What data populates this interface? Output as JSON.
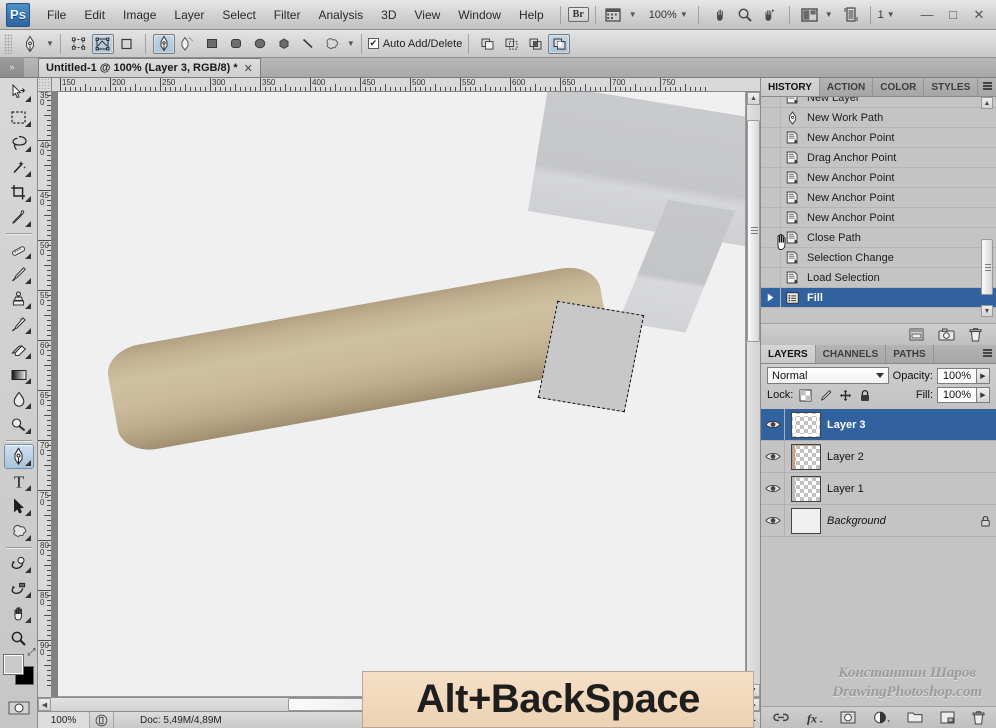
{
  "app": {
    "logo_text": "Ps",
    "window_controls": {
      "minimize": "—",
      "maximize": "□",
      "close": "✕"
    }
  },
  "menubar": {
    "items": [
      "File",
      "Edit",
      "Image",
      "Layer",
      "Select",
      "Filter",
      "Analysis",
      "3D",
      "View",
      "Window",
      "Help"
    ],
    "bridge_label": "Br",
    "zoom_level": "100%",
    "screen_mode_count": "1",
    "icons": [
      "bridge-icon",
      "view-extras-icon",
      "hand-icon",
      "zoom-icon",
      "rotate-view-icon",
      "workspace-icon",
      "screen-mode-icon"
    ]
  },
  "optionsbar": {
    "tool_icon": "pen-tool-icon",
    "mode_buttons": [
      "shape-layers-icon",
      "paths-icon",
      "fill-pixels-icon"
    ],
    "shape_buttons": [
      "pen-icon",
      "freeform-pen-icon",
      "rectangle-icon",
      "rounded-rectangle-icon",
      "ellipse-icon",
      "polygon-icon",
      "line-icon",
      "custom-shape-icon"
    ],
    "auto_add_delete": {
      "label": "Auto Add/Delete",
      "checked": true
    },
    "path_ops": [
      "add-to-path-icon",
      "subtract-from-path-icon",
      "intersect-path-icon",
      "exclude-path-icon"
    ]
  },
  "tabbar": {
    "document_title": "Untitled-1 @ 100% (Layer 3, RGB/8) *",
    "close_label": "✕"
  },
  "toolbox": {
    "tools": [
      {
        "name": "move-tool",
        "active": false
      },
      {
        "name": "rectangular-marquee-tool",
        "active": false
      },
      {
        "name": "lasso-tool",
        "active": false
      },
      {
        "name": "magic-wand-tool",
        "active": false
      },
      {
        "name": "crop-tool",
        "active": false
      },
      {
        "name": "eyedropper-tool",
        "active": false
      },
      {
        "name": "healing-brush-tool",
        "active": false
      },
      {
        "name": "brush-tool",
        "active": false
      },
      {
        "name": "clone-stamp-tool",
        "active": false
      },
      {
        "name": "history-brush-tool",
        "active": false
      },
      {
        "name": "eraser-tool",
        "active": false
      },
      {
        "name": "gradient-tool",
        "active": false
      },
      {
        "name": "blur-tool",
        "active": false
      },
      {
        "name": "dodge-tool",
        "active": false
      },
      {
        "name": "pen-tool",
        "active": true
      },
      {
        "name": "type-tool",
        "active": false
      },
      {
        "name": "path-selection-tool",
        "active": false
      },
      {
        "name": "custom-shape-tool",
        "active": false
      },
      {
        "name": "3d-rotate-tool",
        "active": false
      },
      {
        "name": "3d-orbit-tool",
        "active": false
      },
      {
        "name": "hand-tool",
        "active": false
      },
      {
        "name": "zoom-tool",
        "active": false
      }
    ],
    "foreground_color": "#c9c9c9",
    "background_color": "#000000"
  },
  "rulers": {
    "horizontal_labels": [
      "150",
      "200",
      "250",
      "300",
      "350",
      "400",
      "450",
      "500",
      "550",
      "600",
      "650",
      "700",
      "750"
    ],
    "vertical_labels": [
      "350",
      "400",
      "450",
      "500",
      "550",
      "600",
      "650",
      "700",
      "750",
      "800",
      "850",
      "900"
    ],
    "unit_spacing_px": 50
  },
  "canvas": {
    "artwork_description": "hammer-illustration",
    "handle_color": "#c6b697",
    "head_color": "#c8c9cc",
    "selection_fill": "#c8c8c8",
    "background_color": "#f0f0f0"
  },
  "keyboard_overlay": {
    "text": "Alt+BackSpace",
    "background": "#f2d9bd"
  },
  "history_panel": {
    "tabs": [
      {
        "label": "HISTORY",
        "active": true
      },
      {
        "label": "ACTION",
        "active": false
      },
      {
        "label": "COLOR",
        "active": false
      },
      {
        "label": "STYLES",
        "active": false
      }
    ],
    "items": [
      {
        "label": "New Layer",
        "icon": "history-state-icon",
        "selected": false,
        "partial": true
      },
      {
        "label": "New Work Path",
        "icon": "pen-tool-icon",
        "selected": false
      },
      {
        "label": "New Anchor Point",
        "icon": "history-state-icon",
        "selected": false
      },
      {
        "label": "Drag Anchor Point",
        "icon": "history-state-icon",
        "selected": false
      },
      {
        "label": "New Anchor Point",
        "icon": "history-state-icon",
        "selected": false
      },
      {
        "label": "New Anchor Point",
        "icon": "history-state-icon",
        "selected": false
      },
      {
        "label": "New Anchor Point",
        "icon": "history-state-icon",
        "selected": false
      },
      {
        "label": "Close Path",
        "icon": "history-state-icon",
        "selected": false
      },
      {
        "label": "Selection Change",
        "icon": "history-state-icon",
        "selected": false
      },
      {
        "label": "Load Selection",
        "icon": "history-state-icon",
        "selected": false
      },
      {
        "label": "Fill",
        "icon": "fill-state-icon",
        "selected": true
      }
    ],
    "footer_buttons": [
      "new-document-from-state-icon",
      "new-snapshot-icon",
      "delete-state-icon"
    ]
  },
  "layers_panel": {
    "tabs": [
      {
        "label": "LAYERS",
        "active": true
      },
      {
        "label": "CHANNELS",
        "active": false
      },
      {
        "label": "PATHS",
        "active": false
      }
    ],
    "blend_mode": "Normal",
    "opacity_label": "Opacity:",
    "opacity_value": "100%",
    "fill_label": "Fill:",
    "fill_value": "100%",
    "lock_label": "Lock:",
    "lock_icons": [
      "lock-transparent-pixels-icon",
      "lock-image-pixels-icon",
      "lock-position-icon",
      "lock-all-icon"
    ],
    "layers": [
      {
        "name": "Layer 3",
        "visible": true,
        "selected": true,
        "locked": false,
        "thumb": "transparent"
      },
      {
        "name": "Layer 2",
        "visible": true,
        "selected": false,
        "locked": false,
        "thumb": "transparent"
      },
      {
        "name": "Layer 1",
        "visible": true,
        "selected": false,
        "locked": false,
        "thumb": "transparent"
      },
      {
        "name": "Background",
        "visible": true,
        "selected": false,
        "locked": true,
        "thumb": "solid"
      }
    ],
    "footer_buttons": [
      "link-layers-icon",
      "layer-style-fx-icon",
      "add-layer-mask-icon",
      "new-adjustment-layer-icon",
      "new-group-icon",
      "new-layer-icon",
      "delete-layer-icon"
    ]
  },
  "statusbar": {
    "zoom": "100%",
    "doc_info": "Doc: 5,49M/4,89M"
  },
  "watermark": {
    "line1": "Константин Шаров",
    "line2": "DrawingPhotoshop.com"
  }
}
